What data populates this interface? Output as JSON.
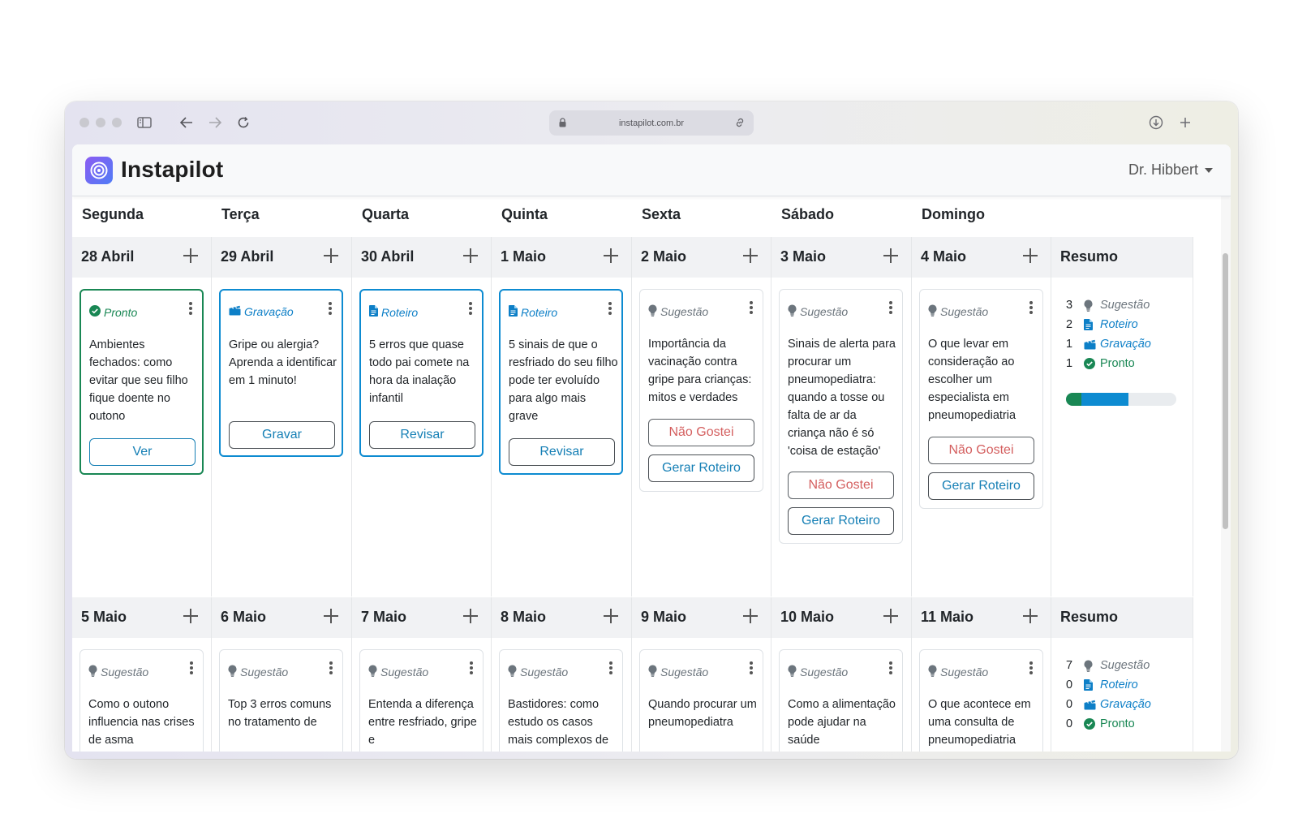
{
  "browser": {
    "url": "instapilot.com.br"
  },
  "app": {
    "brand": "Instapilot",
    "user": "Dr. Hibbert"
  },
  "days": [
    "Segunda",
    "Terça",
    "Quarta",
    "Quinta",
    "Sexta",
    "Sábado",
    "Domingo"
  ],
  "labels": {
    "summary": "Resumo",
    "sugestao": "Sugestão",
    "roteiro": "Roteiro",
    "gravacao": "Gravação",
    "pronto": "Pronto"
  },
  "colors": {
    "ready": "#198754",
    "active": "#0d8bd1",
    "primary": "#157fb5",
    "danger": "#d45f5f"
  },
  "weeks": [
    {
      "dates": [
        "28 Abril",
        "29 Abril",
        "30 Abril",
        "1 Maio",
        "2 Maio",
        "3 Maio",
        "4 Maio"
      ],
      "cards": [
        {
          "status": "Pronto",
          "type": "ready",
          "icon": "check-circle-icon",
          "text": "Ambientes fechados: como evitar que seu filho fique doente no outono",
          "buttons": [
            {
              "label": "Ver",
              "style": "blue"
            }
          ]
        },
        {
          "status": "Gravação",
          "type": "active",
          "icon": "clapperboard-icon",
          "text": "Gripe ou alergia? Aprenda a identificar em 1 minuto!",
          "buttons": [
            {
              "label": "Gravar",
              "style": "dark"
            }
          ]
        },
        {
          "status": "Roteiro",
          "type": "active",
          "icon": "document-icon",
          "text": "5 erros que quase todo pai comete na hora da inalação infantil",
          "buttons": [
            {
              "label": "Revisar",
              "style": "dark"
            }
          ]
        },
        {
          "status": "Roteiro",
          "type": "active",
          "icon": "document-icon",
          "text": "5 sinais de que o resfriado do seu filho pode ter evoluído para algo mais grave",
          "buttons": [
            {
              "label": "Revisar",
              "style": "dark"
            }
          ]
        },
        {
          "status": "Sugestão",
          "type": "plain",
          "icon": "lightbulb-icon",
          "text": "Importância da vacinação contra gripe para crianças: mitos e verdades",
          "buttons": [
            {
              "label": "Não Gostei",
              "style": "red"
            },
            {
              "label": "Gerar Roteiro",
              "style": "dark"
            }
          ]
        },
        {
          "status": "Sugestão",
          "type": "plain",
          "icon": "lightbulb-icon",
          "text": "Sinais de alerta para procurar um pneumopediatra: quando a tosse ou falta de ar da criança não é só 'coisa de estação'",
          "buttons": [
            {
              "label": "Não Gostei",
              "style": "red"
            },
            {
              "label": "Gerar Roteiro",
              "style": "dark"
            }
          ]
        },
        {
          "status": "Sugestão",
          "type": "plain",
          "icon": "lightbulb-icon",
          "text": "O que levar em consideração ao escolher um especialista em pneumopediatria",
          "buttons": [
            {
              "label": "Não Gostei",
              "style": "red"
            },
            {
              "label": "Gerar Roteiro",
              "style": "dark"
            }
          ]
        }
      ],
      "summary": {
        "sugestao": 3,
        "roteiro": 2,
        "gravacao": 1,
        "pronto": 1
      },
      "progress": {
        "pronto": 0.14,
        "active": 0.43
      }
    },
    {
      "dates": [
        "5 Maio",
        "6 Maio",
        "7 Maio",
        "8 Maio",
        "9 Maio",
        "10 Maio",
        "11 Maio"
      ],
      "cards": [
        {
          "status": "Sugestão",
          "type": "plain",
          "icon": "lightbulb-icon",
          "text": "Como o outono influencia nas crises de asma",
          "buttons": []
        },
        {
          "status": "Sugestão",
          "type": "plain",
          "icon": "lightbulb-icon",
          "text": "Top 3 erros comuns no tratamento de",
          "buttons": []
        },
        {
          "status": "Sugestão",
          "type": "plain",
          "icon": "lightbulb-icon",
          "text": "Entenda a diferença entre resfriado, gripe e",
          "buttons": []
        },
        {
          "status": "Sugestão",
          "type": "plain",
          "icon": "lightbulb-icon",
          "text": "Bastidores: como estudo os casos mais complexos de",
          "buttons": []
        },
        {
          "status": "Sugestão",
          "type": "plain",
          "icon": "lightbulb-icon",
          "text": "Quando procurar um pneumopediatra",
          "buttons": []
        },
        {
          "status": "Sugestão",
          "type": "plain",
          "icon": "lightbulb-icon",
          "text": "Como a alimentação pode ajudar na saúde",
          "buttons": []
        },
        {
          "status": "Sugestão",
          "type": "plain",
          "icon": "lightbulb-icon",
          "text": "O que acontece em uma consulta de pneumopediatria",
          "buttons": []
        }
      ],
      "summary": {
        "sugestao": 7,
        "roteiro": 0,
        "gravacao": 0,
        "pronto": 0
      },
      "progress": null
    }
  ]
}
